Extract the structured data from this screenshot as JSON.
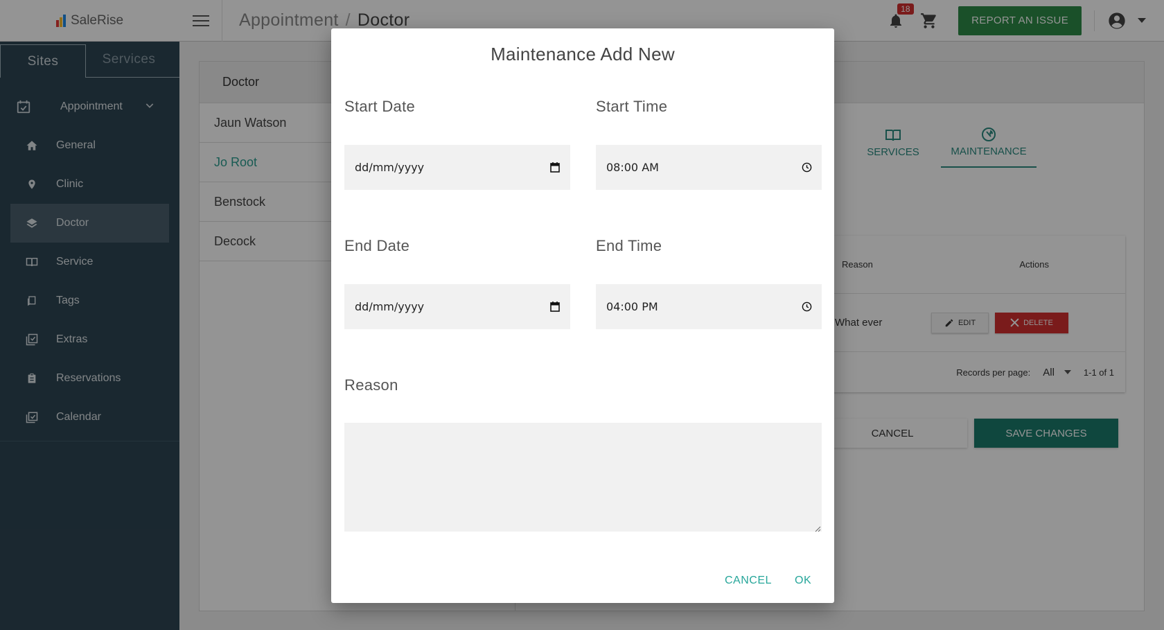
{
  "app": {
    "logo_text": "SaleRise"
  },
  "sidebar": {
    "tabs": [
      {
        "label": "Sites"
      },
      {
        "label": "Services"
      }
    ],
    "parent": {
      "label": "Appointment"
    },
    "items": [
      {
        "label": "General"
      },
      {
        "label": "Clinic"
      },
      {
        "label": "Doctor"
      },
      {
        "label": "Service"
      },
      {
        "label": "Tags"
      },
      {
        "label": "Extras"
      },
      {
        "label": "Reservations"
      },
      {
        "label": "Calendar"
      }
    ]
  },
  "topbar": {
    "breadcrumb": [
      "Appointment",
      "Doctor"
    ],
    "breadcrumb_sep": "/",
    "notification_count": "18",
    "report_label": "REPORT AN ISSUE"
  },
  "background": {
    "card_title": "Doctor",
    "doctors": [
      "Jaun Watson",
      "Jo Root",
      "Benstock",
      "Decock"
    ],
    "tabs": [
      {
        "label": "SERVICES"
      },
      {
        "label": "MAINTENANCE"
      }
    ],
    "table": {
      "headers": {
        "reason": "Reason",
        "actions": "Actions"
      },
      "rows": [
        {
          "reason": "What ever",
          "edit": "EDIT",
          "delete": "DELETE"
        }
      ],
      "footer": {
        "records_label": "Records per page:",
        "records_value": "All",
        "range": "1-1 of 1"
      }
    },
    "cancel_label": "CANCEL",
    "save_label": "SAVE CHANGES"
  },
  "dialog": {
    "title": "Maintenance Add New",
    "start_date": {
      "label": "Start Date",
      "value": "dd/mm/yyyy"
    },
    "start_time": {
      "label": "Start Time",
      "value": "08:00 AM"
    },
    "end_date": {
      "label": "End Date",
      "value": "dd/mm/yyyy"
    },
    "end_time": {
      "label": "End Time",
      "value": "04:00 PM"
    },
    "reason": {
      "label": "Reason",
      "value": ""
    },
    "cancel_label": "CANCEL",
    "ok_label": "OK"
  },
  "colors": {
    "sidebar": "#2e4553",
    "accent": "#26a69a",
    "report": "#2e8b47",
    "danger": "#d32f2f",
    "save": "#1b7a6c"
  }
}
